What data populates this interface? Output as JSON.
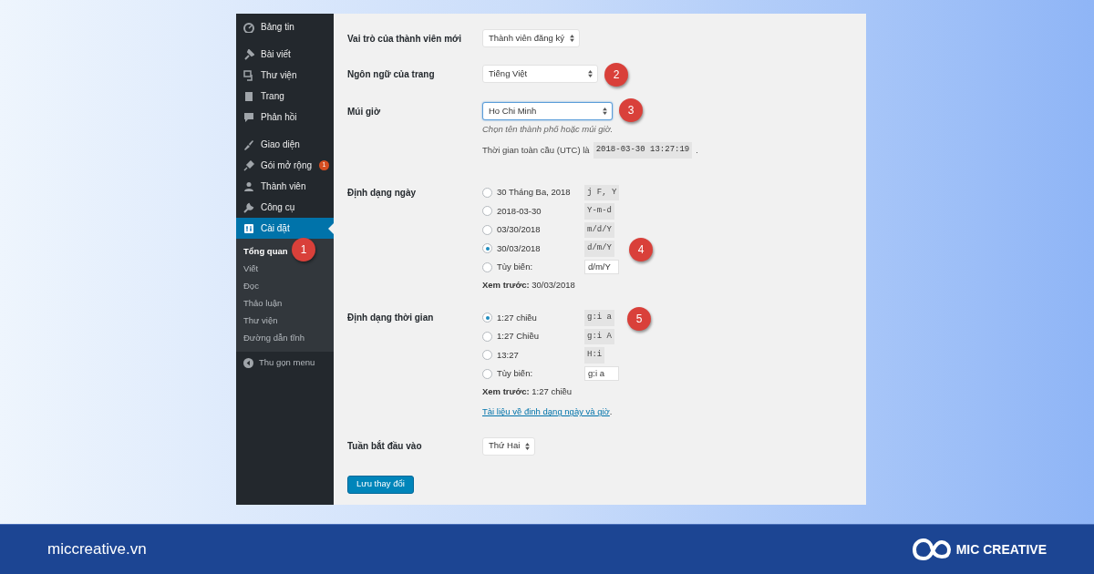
{
  "sidebar": {
    "groups": [
      [
        {
          "label": "Bảng tin",
          "selected": false
        }
      ],
      [
        {
          "label": "Bài viết",
          "selected": false
        },
        {
          "label": "Thư viện",
          "selected": false
        },
        {
          "label": "Trang",
          "selected": false
        },
        {
          "label": "Phản hồi",
          "selected": false
        }
      ],
      [
        {
          "label": "Giao diện",
          "selected": false
        },
        {
          "label": "Gói mở rộng",
          "badge": "1",
          "selected": false
        },
        {
          "label": "Thành viên",
          "selected": false
        },
        {
          "label": "Công cụ",
          "selected": false
        },
        {
          "label": "Cài đặt",
          "selected": true,
          "children": [
            {
              "label": "Tổng quan",
              "selected": true
            },
            {
              "label": "Viết",
              "selected": false
            },
            {
              "label": "Đọc",
              "selected": false
            },
            {
              "label": "Thảo luận",
              "selected": false
            },
            {
              "label": "Thư viện",
              "selected": false
            },
            {
              "label": "Đường dẫn tĩnh",
              "selected": false
            }
          ]
        }
      ]
    ],
    "collapse": "Thu gọn menu"
  },
  "settings": [
    {
      "kind": "select",
      "label": "Vai trò của thành viên mới",
      "value": "Thành viên đăng ký",
      "focused": false
    },
    {
      "kind": "select",
      "label": "Ngôn ngữ của trang",
      "value": "Tiếng Việt",
      "focused": false
    },
    {
      "kind": "select",
      "label": "Múi giờ",
      "value": "Ho Chi Minh",
      "focused": true,
      "hint": "Chọn tên thành phố hoặc múi giờ.",
      "note": {
        "text": "Thời gian toàn cầu (UTC) là",
        "code": "2018-03-30 13:27:19",
        "end": "."
      }
    },
    {
      "kind": "radios",
      "label": "Định dạng ngày",
      "options": [
        {
          "label": "30 Tháng Ba, 2018",
          "format": "j F, Y",
          "selected": false
        },
        {
          "label": "2018-03-30",
          "format": "Y-m-d",
          "selected": false
        },
        {
          "label": "03/30/2018",
          "format": "m/d/Y",
          "selected": false
        },
        {
          "label": "30/03/2018",
          "format": "d/m/Y",
          "selected": true
        },
        {
          "label": "Tùy biến:",
          "value": "d/m/Y",
          "kind": "custom",
          "selected": false
        }
      ],
      "preview": "**Xem trước:** 30/03/2018"
    },
    {
      "kind": "radios",
      "label": "Định dạng thời gian",
      "options": [
        {
          "label": "1:27 chiều",
          "format": "g:i a",
          "selected": true
        },
        {
          "label": "1:27 Chiều",
          "format": "g:i A",
          "selected": false
        },
        {
          "label": "13:27",
          "format": "H:i",
          "selected": false
        },
        {
          "label": "Tùy biến:",
          "value": "g:i a",
          "kind": "custom",
          "selected": false
        }
      ],
      "preview": "**Xem trước:** 1:27 chiều",
      "link": "Tài liệu về định dạng ngày và giờ",
      "link_end": "."
    },
    {
      "kind": "select",
      "label": "Tuần bắt đầu vào",
      "value": "Thứ Hai",
      "focused": false
    }
  ],
  "save_button": "Lưu thay đổi",
  "markers": [
    "1",
    "2",
    "3",
    "4",
    "5"
  ],
  "footer": {
    "site": "miccreative.vn",
    "brand": "MIC CREATIVE"
  }
}
